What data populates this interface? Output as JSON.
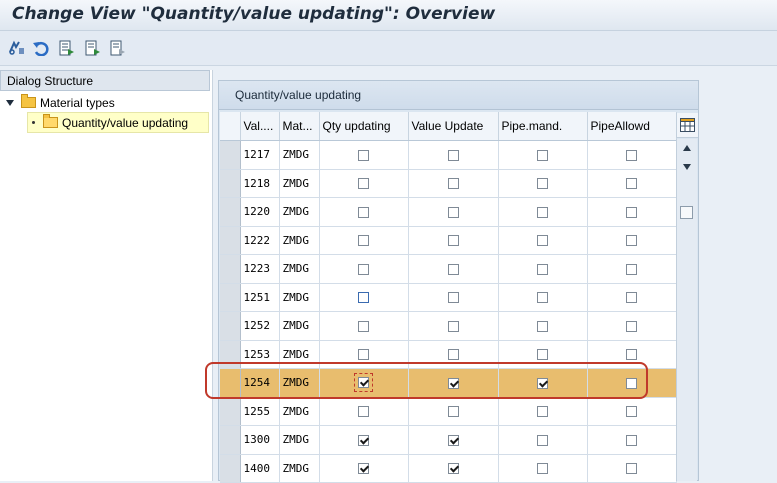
{
  "window": {
    "title": "Change View \"Quantity/value updating\": Overview"
  },
  "toolbar": {
    "buttons": [
      "display-change-icon",
      "undo-icon",
      "select-all-icon",
      "select-block-icon",
      "deselect-all-icon"
    ]
  },
  "dialog_structure": {
    "header": "Dialog Structure",
    "items": [
      {
        "label": "Material types",
        "level": 0,
        "expanded": true
      },
      {
        "label": "Quantity/value updating",
        "level": 1,
        "selected": true
      }
    ]
  },
  "table": {
    "title": "Quantity/value updating",
    "columns": [
      "Val....",
      "Mat...",
      "Qty updating",
      "Value Update",
      "Pipe.mand.",
      "PipeAllowd"
    ],
    "rows": [
      {
        "val": "1217",
        "mat": "ZMDG",
        "qty": false,
        "value": false,
        "pipe_mand": false,
        "pipe_allowd": false
      },
      {
        "val": "1218",
        "mat": "ZMDG",
        "qty": false,
        "value": false,
        "pipe_mand": false,
        "pipe_allowd": false
      },
      {
        "val": "1220",
        "mat": "ZMDG",
        "qty": false,
        "value": false,
        "pipe_mand": false,
        "pipe_allowd": false
      },
      {
        "val": "1222",
        "mat": "ZMDG",
        "qty": false,
        "value": false,
        "pipe_mand": false,
        "pipe_allowd": false
      },
      {
        "val": "1223",
        "mat": "ZMDG",
        "qty": false,
        "value": false,
        "pipe_mand": false,
        "pipe_allowd": false
      },
      {
        "val": "1251",
        "mat": "ZMDG",
        "qty": false,
        "value": false,
        "pipe_mand": false,
        "pipe_allowd": false,
        "qty_focus": true
      },
      {
        "val": "1252",
        "mat": "ZMDG",
        "qty": false,
        "value": false,
        "pipe_mand": false,
        "pipe_allowd": false
      },
      {
        "val": "1253",
        "mat": "ZMDG",
        "qty": false,
        "value": false,
        "pipe_mand": false,
        "pipe_allowd": false
      },
      {
        "val": "1254",
        "mat": "ZMDG",
        "qty": true,
        "value": true,
        "pipe_mand": true,
        "pipe_allowd": false,
        "highlighted": true
      },
      {
        "val": "1255",
        "mat": "ZMDG",
        "qty": false,
        "value": false,
        "pipe_mand": false,
        "pipe_allowd": false
      },
      {
        "val": "1300",
        "mat": "ZMDG",
        "qty": true,
        "value": true,
        "pipe_mand": false,
        "pipe_allowd": false
      },
      {
        "val": "1400",
        "mat": "ZMDG",
        "qty": true,
        "value": true,
        "pipe_mand": false,
        "pipe_allowd": false
      }
    ]
  },
  "colors": {
    "highlight_row": "#e8bd6e",
    "annotation": "#c0392b",
    "folder": "#f5c342"
  }
}
